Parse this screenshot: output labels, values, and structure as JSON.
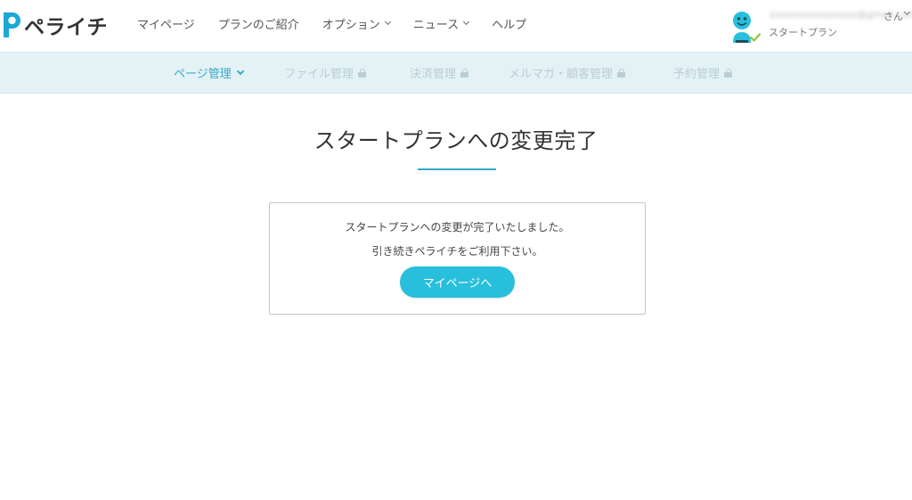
{
  "header": {
    "logo_text": "ペライチ",
    "nav": [
      {
        "label": "マイページ",
        "dropdown": false
      },
      {
        "label": "プランのご紹介",
        "dropdown": false
      },
      {
        "label": "オプション",
        "dropdown": true
      },
      {
        "label": "ニュース",
        "dropdown": true
      },
      {
        "label": "ヘルプ",
        "dropdown": false
      }
    ],
    "user": {
      "email": "xxxxxxxxxxxxxxx@gmail.com",
      "suffix": "さん",
      "plan": "スタートプラン"
    }
  },
  "subnav": {
    "items": [
      {
        "label": "ページ管理",
        "state": "active"
      },
      {
        "label": "ファイル管理",
        "state": "locked"
      },
      {
        "label": "決済管理",
        "state": "locked"
      },
      {
        "label": "メルマガ・顧客管理",
        "state": "locked"
      },
      {
        "label": "予約管理",
        "state": "locked"
      }
    ]
  },
  "main": {
    "title": "スタートプランへの変更完了",
    "message_line1": "スタートプランへの変更が完了いたしました。",
    "message_line2": "引き続きペライチをご利用下さい。",
    "button_label": "マイページへ"
  },
  "colors": {
    "accent": "#27bfdc",
    "accent_dark": "#3aa7c9",
    "subnav_bg": "#e4f2f6",
    "locked_text": "#b9cdd4",
    "check": "#8cc63f"
  },
  "icons": {
    "logo": "perai-p-logo-icon",
    "avatar": "user-avatar-icon",
    "check": "check-icon",
    "lock": "lock-icon",
    "chevron": "chevron-down-icon"
  }
}
